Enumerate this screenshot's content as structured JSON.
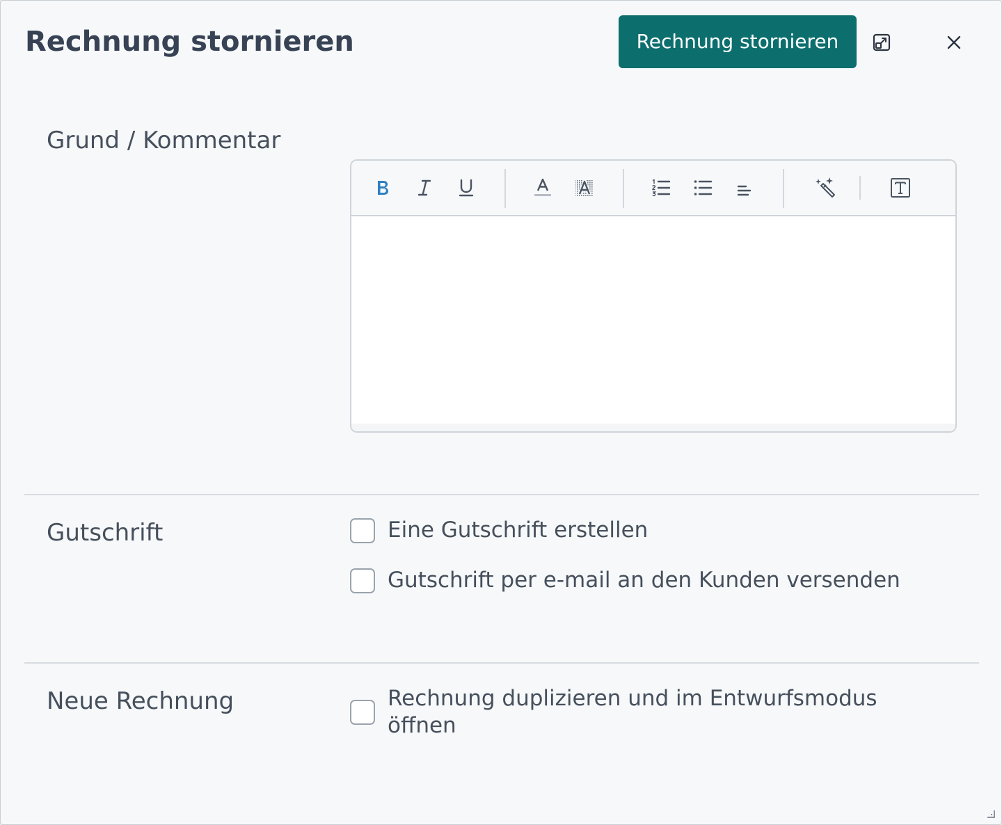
{
  "dialog": {
    "title": "Rechnung stornieren",
    "primary_button": "Rechnung stornieren",
    "expand_icon": "expand-icon",
    "close_icon": "close-icon"
  },
  "sections": {
    "comment": {
      "label": "Grund / Kommentar",
      "editor_value": ""
    },
    "credit_note": {
      "label": "Gutschrift",
      "options": [
        {
          "label": "Eine Gutschrift erstellen",
          "checked": false
        },
        {
          "label": "Gutschrift per e-mail an den Kunden versenden",
          "checked": false
        }
      ]
    },
    "new_invoice": {
      "label": "Neue Rechnung",
      "options": [
        {
          "label": "Rechnung duplizieren und im Entwurfsmodus öffnen",
          "checked": false
        }
      ]
    }
  },
  "toolbar": {
    "buttons": [
      "bold-icon",
      "italic-icon",
      "underline-icon",
      "text-color-icon",
      "highlight-icon",
      "ordered-list-icon",
      "bullet-list-icon",
      "align-icon",
      "magic-wand-icon",
      "text-block-icon"
    ]
  },
  "colors": {
    "accent": "#0d6e6e",
    "bold_active": "#2f7fc1",
    "text": "#46505c",
    "title": "#374354",
    "background": "#f6f8fa"
  }
}
